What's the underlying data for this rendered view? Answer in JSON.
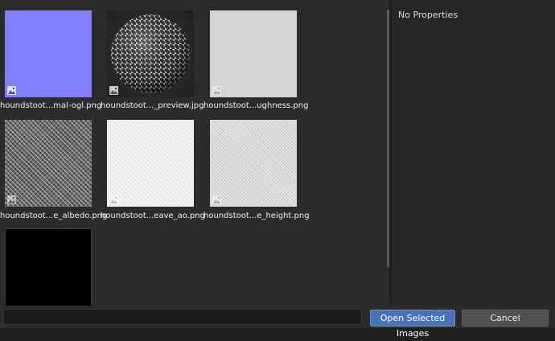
{
  "files": [
    {
      "label": "houndstoot...mal-ogl.png",
      "kind": "normal"
    },
    {
      "label": "houndstoot..._preview.jpg",
      "kind": "preview"
    },
    {
      "label": "houndstoot...ughness.png",
      "kind": "roughness"
    },
    {
      "label": "houndstoot...e_albedo.png",
      "kind": "albedo"
    },
    {
      "label": "houndstoot...eave_ao.png",
      "kind": "ao"
    },
    {
      "label": "houndstoot...e_height.png",
      "kind": "height"
    },
    {
      "label": "",
      "kind": "black"
    }
  ],
  "properties": {
    "empty_text": "No Properties"
  },
  "footer": {
    "path_value": "",
    "open_label": "Open Selected Images",
    "cancel_label": "Cancel"
  },
  "icons": {
    "image_badge": "image-icon"
  },
  "colors": {
    "accent": "#4a72b8",
    "normal_map": "#7f7fff"
  }
}
